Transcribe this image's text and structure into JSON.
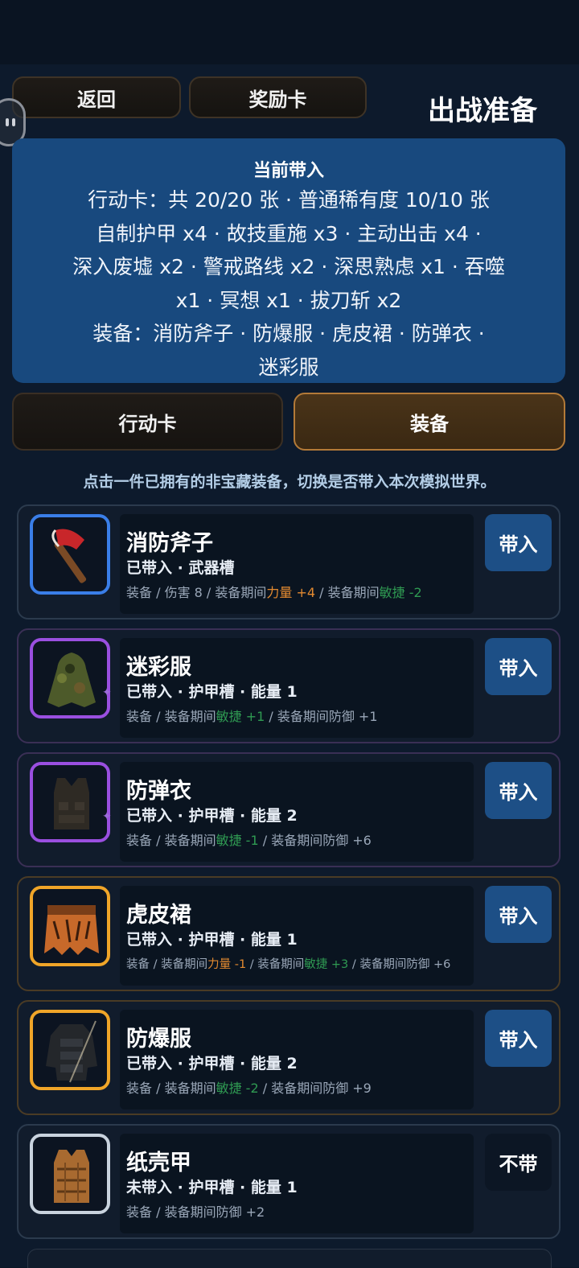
{
  "header": {
    "back_label": "返回",
    "reward_label": "奖励卡",
    "title": "出战准备"
  },
  "summary": {
    "title": "当前带入",
    "lines": [
      "行动卡：共 20/20 张 · 普通稀有度 10/10 张",
      "自制护甲 x4 · 故技重施 x3 · 主动出击 x4 ·",
      "深入废墟 x2 · 警戒路线 x2 · 深思熟虑 x1 · 吞噬",
      "x1 · 冥想 x1 · 拔刀斩 x2",
      "装备：消防斧子 · 防爆服 · 虎皮裙 · 防弹衣 ·",
      "迷彩服"
    ]
  },
  "tabs": {
    "action_label": "行动卡",
    "equip_label": "装备"
  },
  "hint": "点击一件已拥有的非宝藏装备，切换是否带入本次模拟世界。",
  "equipment": [
    {
      "name": "消防斧子",
      "status": "已带入 · 武器槽",
      "stats": [
        {
          "t": "装备 / 伤害 8 / 装备期间"
        },
        {
          "t": "力量 +4",
          "c": "str"
        },
        {
          "t": " / 装备期间"
        },
        {
          "t": "敏捷 -2",
          "c": "dex"
        }
      ],
      "button": "带入",
      "icon": "axe-icon",
      "rarity_color": "#3a7ee8"
    },
    {
      "name": "迷彩服",
      "status": "已带入 · 护甲槽 · 能量 1",
      "stats": [
        {
          "t": "装备 / 装备期间"
        },
        {
          "t": "敏捷 +1",
          "c": "dex"
        },
        {
          "t": " / 装备期间防御 +1"
        }
      ],
      "button": "带入",
      "icon": "ghillie-suit-icon",
      "rarity_color": "#9a4fe0"
    },
    {
      "name": "防弹衣",
      "status": "已带入 · 护甲槽 · 能量 2",
      "stats": [
        {
          "t": "装备 / 装备期间"
        },
        {
          "t": "敏捷 -1",
          "c": "dex"
        },
        {
          "t": " / 装备期间防御 +6"
        }
      ],
      "button": "带入",
      "icon": "bulletproof-vest-icon",
      "rarity_color": "#9a4fe0"
    },
    {
      "name": "虎皮裙",
      "status": "已带入 · 护甲槽 · 能量 1",
      "stats": [
        {
          "t": "装备 / 装备期间"
        },
        {
          "t": "力量 -1",
          "c": "str"
        },
        {
          "t": " / 装备期间"
        },
        {
          "t": "敏捷 +3",
          "c": "dex"
        },
        {
          "t": " / 装备期间防御 +6"
        }
      ],
      "button": "带入",
      "icon": "tiger-skirt-icon",
      "rarity_color": "#f0a528"
    },
    {
      "name": "防爆服",
      "status": "已带入 · 护甲槽 · 能量 2",
      "stats": [
        {
          "t": "装备 / 装备期间"
        },
        {
          "t": "敏捷 -2",
          "c": "dex"
        },
        {
          "t": " / 装备期间防御 +9"
        }
      ],
      "button": "带入",
      "icon": "bomb-suit-icon",
      "rarity_color": "#f0a528"
    },
    {
      "name": "纸壳甲",
      "status": "未带入 · 护甲槽 · 能量 1",
      "stats": [
        {
          "t": "装备 / 装备期间防御 +2"
        }
      ],
      "button": "不带",
      "icon": "cardboard-armor-icon",
      "rarity_color": "#c9d3de"
    }
  ]
}
